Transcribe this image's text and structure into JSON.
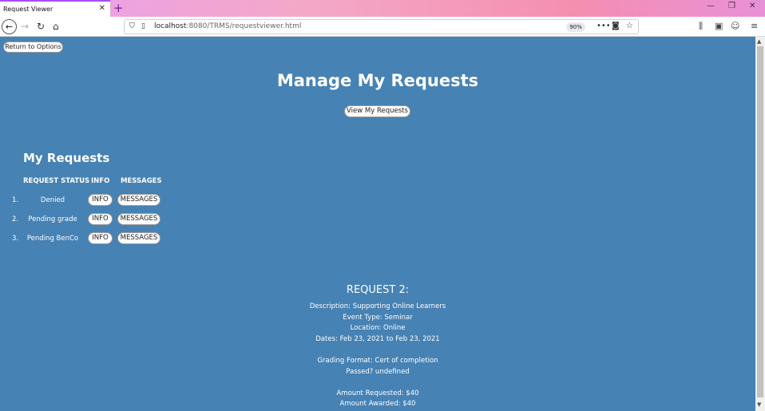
{
  "browser": {
    "tab_title": "Request Viewer",
    "url_host": "localhost",
    "url_rest": ":8080/TRMS/requestviewer.html",
    "zoom": "90%"
  },
  "page": {
    "return_label": "Return to Options",
    "title": "Manage My Requests",
    "view_label": "View My Requests",
    "section_title": "My Requests",
    "headers": {
      "status": "REQUEST STATUS",
      "info": "INFO",
      "messages": "MESSAGES"
    },
    "requests": [
      {
        "num": "1.",
        "status": "Denied",
        "info": "INFO",
        "messages": "MESSAGES"
      },
      {
        "num": "2.",
        "status": "Pending grade",
        "info": "INFO",
        "messages": "MESSAGES"
      },
      {
        "num": "3.",
        "status": "Pending BenCo",
        "info": "INFO",
        "messages": "MESSAGES"
      }
    ],
    "detail": {
      "title": "REQUEST 2:",
      "description": "Description: Supporting Online Learners",
      "event_type": "Event Type: Seminar",
      "location": "Location: Online",
      "dates": "Dates: Feb 23, 2021 to Feb 23, 2021",
      "grading": "Grading Format: Cert of completion",
      "passed": "Passed? undefined",
      "requested": "Amount Requested: $40",
      "awarded": "Amount Awarded: $40"
    }
  },
  "colors": {
    "background": "#4682b4",
    "text": "#ffffff"
  }
}
